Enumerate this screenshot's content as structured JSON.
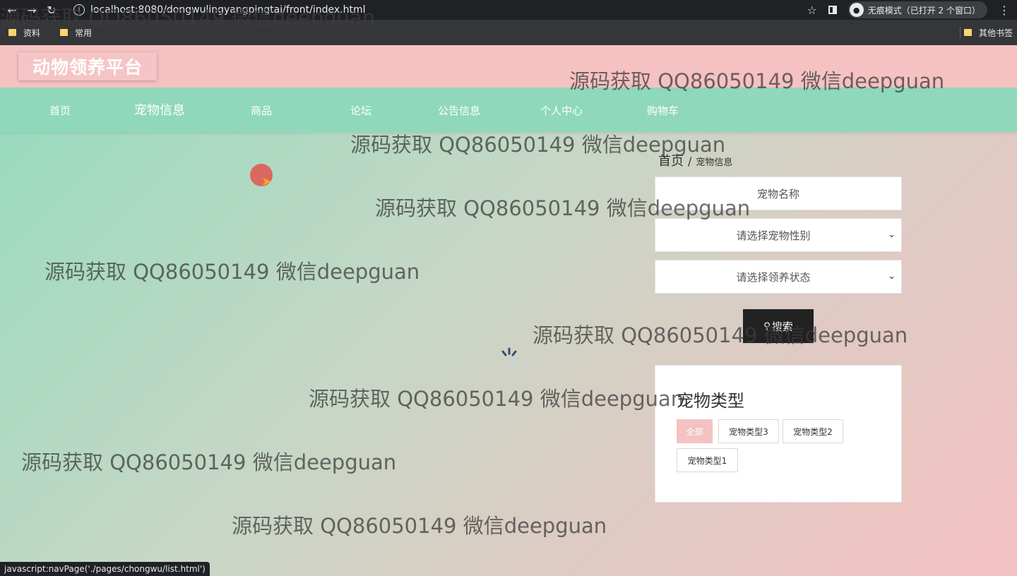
{
  "browser": {
    "url": "localhost:8080/dongwulingyangpingtai/front/index.html",
    "incognito_label": "无痕模式（已打开 2 个窗口）",
    "bookmarks": [
      "资料",
      "常用"
    ],
    "other_bookmarks": "其他书签",
    "status_text": "javascript:navPage('./pages/chongwu/list.html')"
  },
  "site": {
    "logo": "动物领养平台",
    "nav": [
      {
        "label": "首页"
      },
      {
        "label": "宠物信息"
      },
      {
        "label": "商品"
      },
      {
        "label": "论坛"
      },
      {
        "label": "公告信息"
      },
      {
        "label": "个人中心"
      },
      {
        "label": "购物车"
      }
    ]
  },
  "breadcrumb": {
    "home": "首页",
    "separator": "/",
    "current": "宠物信息"
  },
  "filters": {
    "name_placeholder": "宠物名称",
    "gender_select": "请选择宠物性别",
    "status_select": "请选择领养状态",
    "search_button": "搜索"
  },
  "types": {
    "title": "宠物类型",
    "tags": [
      "全部",
      "宠物类型3",
      "宠物类型2",
      "宠物类型1"
    ],
    "active_tag": "全部"
  },
  "watermark": "源码获取 QQ86050149 微信deepguan",
  "colors": {
    "header_pink": "#f6c1c1",
    "nav_green": "#8fd8bb",
    "active_tag": "#f4c2c2",
    "search_button": "#222222"
  }
}
